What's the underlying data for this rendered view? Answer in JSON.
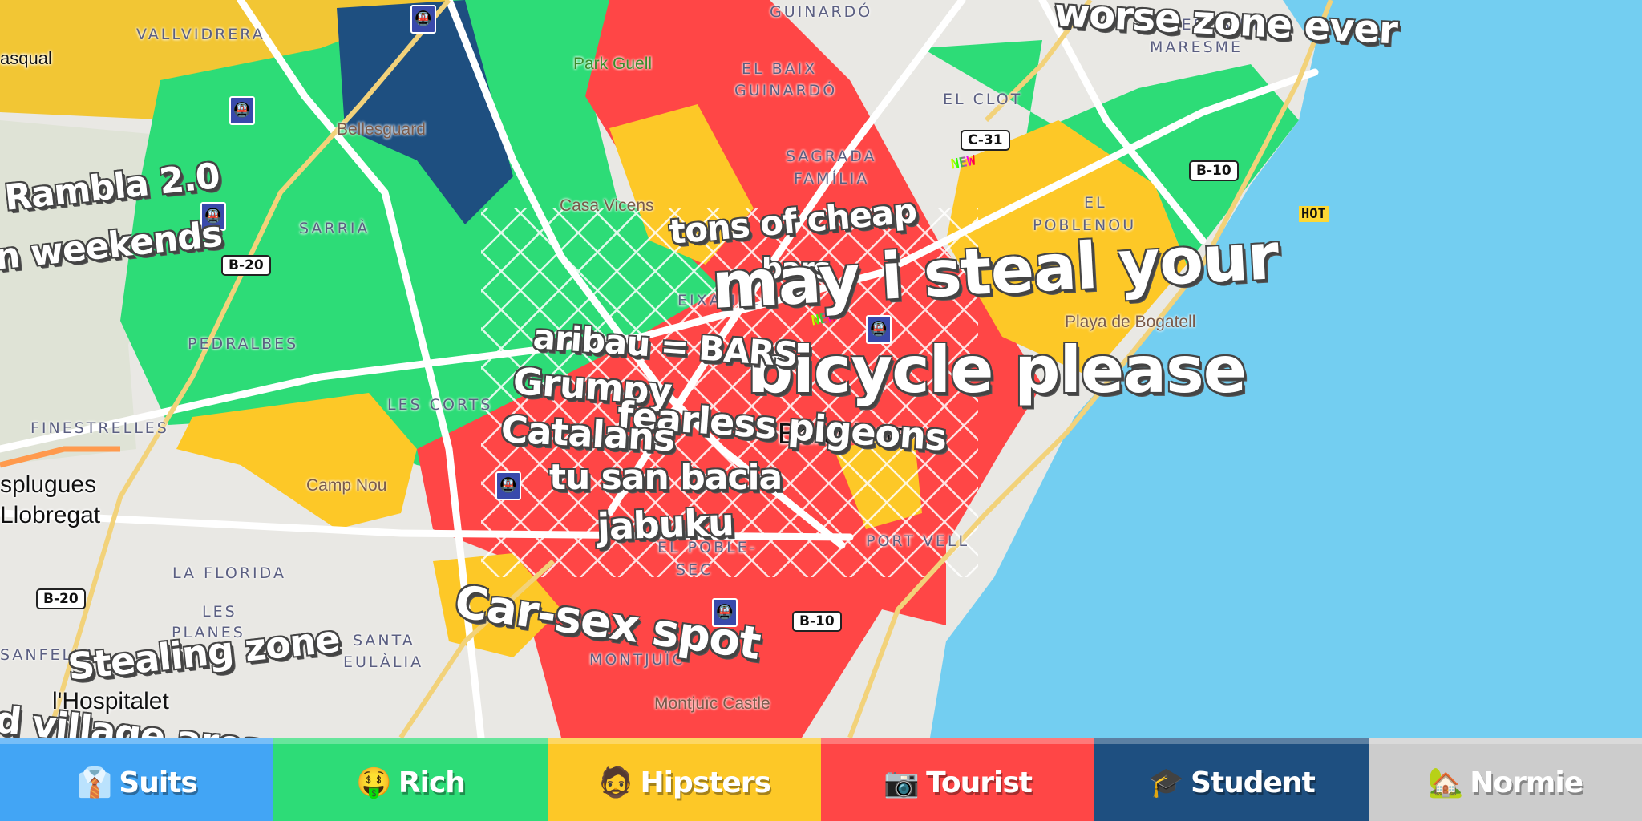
{
  "colors": {
    "land": "#e9e8e4",
    "sea": "#73cef1",
    "suits": "#42a5f5",
    "rich": "#2ddc77",
    "hipsters": "#fdc827",
    "tourist": "#ff4646",
    "student": "#1e4f80",
    "normie": "#cccccc"
  },
  "map": {
    "user_labels": [
      "worse zone ever",
      "Rambla 2.0",
      "n weekends",
      "tons of cheap",
      "bars",
      "may i steal your",
      "bicycle please",
      "aribau = BARS",
      "Grumpy",
      "fearless pigeons",
      "Catalans",
      "tu san bacia",
      "jabuku",
      "Car-sex spot",
      "Stealing zone",
      "d village area"
    ],
    "districts": [
      "VALLVIDRERA",
      "GUINARDÓ",
      "EL BESÒS I EL",
      "MARESME",
      "EL BAIX",
      "GUINARDÓ",
      "EL CLOT",
      "SAGRADA",
      "FAMÍLIA",
      "EL",
      "POBLENOU",
      "SARRIÀ",
      "PEDRALBES",
      "EIXAMPLE",
      "LES CORTS",
      "FINESTRELLES",
      "LA FLORIDA",
      "LES",
      "PLANES",
      "SANTA",
      "EULÀLIA",
      "SANFELIU",
      "EL POBLE-",
      "SEC",
      "MONTJUÏC",
      "PORT VELL"
    ],
    "pois": [
      "Bellesguard",
      "Park Guell",
      "Casa Vicens",
      "Camp Nou",
      "Playa de Bogatell",
      "Montjuïc Castle"
    ],
    "cities": [
      "Barcelona",
      "splugues",
      "Llobregat",
      "l'Hospitalet",
      "asqual"
    ],
    "roads": [
      "B-20",
      "B-20",
      "C-31",
      "B-10",
      "B-10"
    ],
    "badges": [
      "NEW",
      "NEW",
      "HOT"
    ]
  },
  "legend": [
    {
      "label": "Suits",
      "icon": "👔",
      "icon_name": "necktie-icon"
    },
    {
      "label": "Rich",
      "icon": "🤑",
      "icon_name": "money-face-icon"
    },
    {
      "label": "Hipsters",
      "icon": "🧔",
      "icon_name": "bearded-man-icon"
    },
    {
      "label": "Tourist",
      "icon": "📷",
      "icon_name": "camera-icon"
    },
    {
      "label": "Student",
      "icon": "🎓",
      "icon_name": "graduation-cap-icon"
    },
    {
      "label": "Normie",
      "icon": "🏡",
      "icon_name": "house-icon"
    }
  ]
}
